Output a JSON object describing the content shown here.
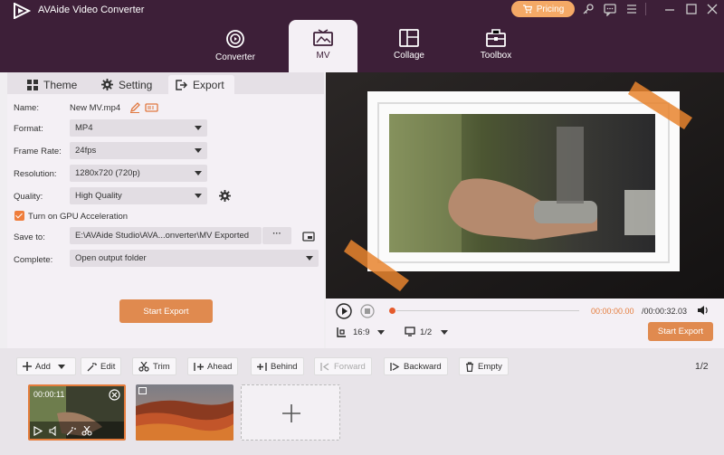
{
  "app": {
    "title": "AVAide Video Converter",
    "pricing_label": "Pricing"
  },
  "nav": {
    "tabs": [
      {
        "label": "Converter"
      },
      {
        "label": "MV"
      },
      {
        "label": "Collage"
      },
      {
        "label": "Toolbox"
      }
    ]
  },
  "subtabs": {
    "theme": "Theme",
    "setting": "Setting",
    "export": "Export"
  },
  "export": {
    "name_label": "Name:",
    "name_value": "New MV.mp4",
    "format_label": "Format:",
    "format_value": "MP4",
    "frame_rate_label": "Frame Rate:",
    "frame_rate_value": "24fps",
    "resolution_label": "Resolution:",
    "resolution_value": "1280x720 (720p)",
    "quality_label": "Quality:",
    "quality_value": "High Quality",
    "gpu_label": "Turn on GPU Acceleration",
    "save_to_label": "Save to:",
    "save_to_value": "E:\\AVAide Studio\\AVA...onverter\\MV Exported",
    "browse_label": "···",
    "complete_label": "Complete:",
    "complete_value": "Open output folder",
    "start_export": "Start Export"
  },
  "player": {
    "time_current": "00:00:00.00",
    "time_total": "/00:00:32.03",
    "aspect": "16:9",
    "screen": "1/2",
    "start_export": "Start Export"
  },
  "toolbar": {
    "add": "Add",
    "edit": "Edit",
    "trim": "Trim",
    "ahead": "Ahead",
    "behind": "Behind",
    "forward": "Forward",
    "backward": "Backward",
    "empty": "Empty",
    "page": "1/2"
  },
  "clips": {
    "first_duration": "00:00:11"
  },
  "colors": {
    "nav_bg": "#3d1f38",
    "accent": "#e08a4f",
    "pricing": "#f4a966"
  }
}
